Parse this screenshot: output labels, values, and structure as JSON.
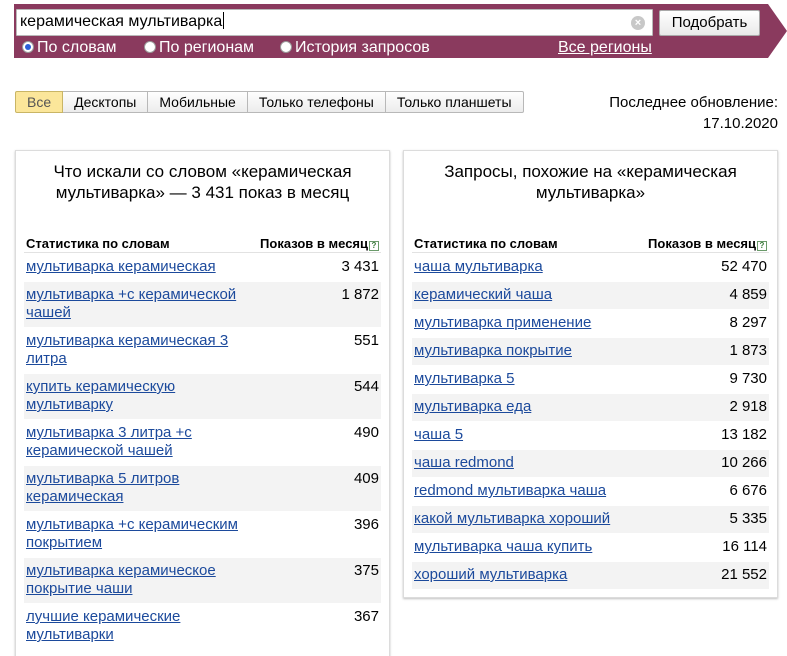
{
  "search": {
    "query": "керамическая мультиварка",
    "button_label": "Подобрать",
    "clear_icon": "x-circle-icon"
  },
  "modes": {
    "by_words": "По словам",
    "by_regions": "По регионам",
    "history": "История запросов",
    "selected": "by_words",
    "all_regions": "Все регионы"
  },
  "devices": {
    "tabs": [
      "Все",
      "Десктопы",
      "Мобильные",
      "Только телефоны",
      "Только планшеты"
    ],
    "active": "Все"
  },
  "updated": {
    "label": "Последнее обновление:",
    "date": "17.10.2020"
  },
  "left_panel": {
    "title": "Что искали со словом «керамическая мультиварка» — 3 431 показ в месяц",
    "col_words": "Статистика по словам",
    "col_shows": "Показов в месяц",
    "rows": [
      {
        "kw": "мультиварка керамическая",
        "val": "3 431"
      },
      {
        "kw": "мультиварка +с керамической чашей",
        "val": "1 872"
      },
      {
        "kw": "мультиварка керамическая 3 литра",
        "val": "551"
      },
      {
        "kw": "купить керамическую мультиварку",
        "val": "544"
      },
      {
        "kw": "мультиварка 3 литра +с керамической чашей",
        "val": "490"
      },
      {
        "kw": "мультиварка 5 литров керамическая",
        "val": "409"
      },
      {
        "kw": "мультиварка +с керамическим покрытием",
        "val": "396"
      },
      {
        "kw": "мультиварка керамическое покрытие чаши",
        "val": "375"
      },
      {
        "kw": "лучшие керамические мультиварки",
        "val": "367"
      }
    ]
  },
  "right_panel": {
    "title": "Запросы, похожие на «керамическая мультиварка»",
    "col_words": "Статистика по словам",
    "col_shows": "Показов в месяц",
    "rows": [
      {
        "kw": "чаша мультиварка",
        "val": "52 470"
      },
      {
        "kw": "керамический чаша",
        "val": "4 859"
      },
      {
        "kw": "мультиварка применение",
        "val": "8 297"
      },
      {
        "kw": "мультиварка покрытие",
        "val": "1 873"
      },
      {
        "kw": "мультиварка 5",
        "val": "9 730"
      },
      {
        "kw": "мультиварка еда",
        "val": "2 918"
      },
      {
        "kw": "чаша 5",
        "val": "13 182"
      },
      {
        "kw": "чаша redmond",
        "val": "10 266"
      },
      {
        "kw": "redmond мультиварка чаша",
        "val": "6 676"
      },
      {
        "kw": "какой мультиварка хороший",
        "val": "5 335"
      },
      {
        "kw": "мультиварка чаша купить",
        "val": "16 114"
      },
      {
        "kw": "хороший мультиварка",
        "val": "21 552"
      }
    ]
  },
  "colors": {
    "header_band": "#8a3a5e",
    "link": "#1c4a9c",
    "active_tab": "#fbe69a"
  }
}
